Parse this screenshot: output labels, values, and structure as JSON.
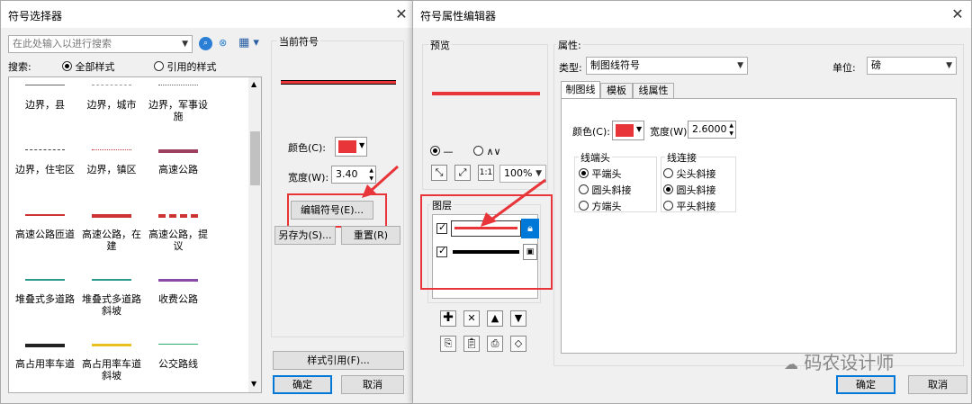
{
  "selector": {
    "title": "符号选择器",
    "search_placeholder": "在此处输入以进行搜索",
    "search_label": "搜索:",
    "scope_all": "全部样式",
    "scope_ref": "引用的样式",
    "symbols": [
      [
        "边界，县",
        "边界，城市",
        "边界，军事设施"
      ],
      [
        "边界，住宅区",
        "边界，镇区",
        "高速公路"
      ],
      [
        "高速公路匝道",
        "高速公路，在建",
        "高速公路，提议"
      ],
      [
        "堆叠式多道路",
        "堆叠式多道路斜坡",
        "收费公路"
      ],
      [
        "高占用率车道",
        "高占用率车道斜坡",
        "公交路线"
      ]
    ],
    "current_symbol": "当前符号",
    "color_label": "颜色(C):",
    "width_label": "宽度(W):",
    "width_value": "3.40",
    "edit_button": "编辑符号(E)...",
    "save_as": "另存为(S)...",
    "reset": "重置(R)",
    "style_ref": "样式引用(F)...",
    "ok": "确定",
    "cancel": "取消"
  },
  "editor": {
    "title": "符号属性编辑器",
    "preview": "预览",
    "zoom": "100%",
    "layers_label": "图层",
    "props_label": "属性:",
    "type_label": "类型:",
    "type_value": "制图线符号",
    "unit_label": "单位:",
    "unit_value": "磅",
    "tabs": [
      "制图线",
      "模板",
      "线属性"
    ],
    "color_label": "颜色(C):",
    "width_label": "宽度(W):",
    "width_value": "2.6000",
    "cap_group": "线端头",
    "caps": [
      "平端头",
      "圆头斜接",
      "方端头"
    ],
    "join_group": "线连接",
    "joins": [
      "尖头斜接",
      "圆头斜接",
      "平头斜接"
    ],
    "ok": "确定",
    "cancel": "取消"
  },
  "watermark": "码农设计师",
  "colors": {
    "accent_red": "#e8353a",
    "highlight": "#0078d7",
    "arrow": "#e8353a"
  }
}
